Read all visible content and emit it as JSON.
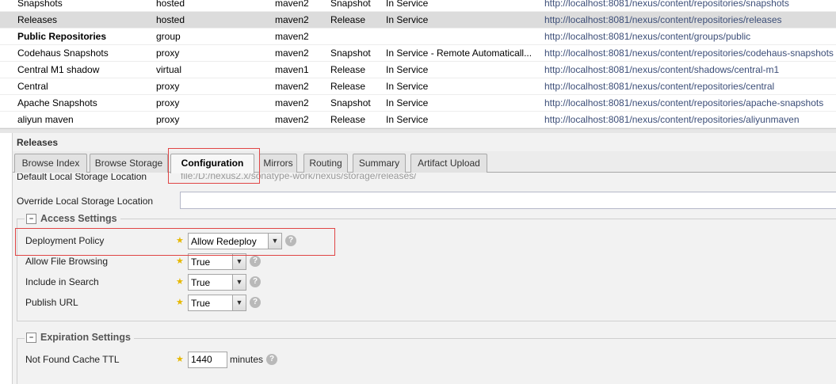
{
  "repositories": [
    {
      "name": "Snapshots",
      "type": "hosted",
      "format": "maven2",
      "policy": "Snapshot",
      "status": "In Service",
      "url": "http://localhost:8081/nexus/content/repositories/snapshots"
    },
    {
      "name": "Releases",
      "type": "hosted",
      "format": "maven2",
      "policy": "Release",
      "status": "In Service",
      "url": "http://localhost:8081/nexus/content/repositories/releases"
    },
    {
      "name": "Public Repositories",
      "type": "group",
      "format": "maven2",
      "policy": "",
      "status": "",
      "url": "http://localhost:8081/nexus/content/groups/public"
    },
    {
      "name": "Codehaus Snapshots",
      "type": "proxy",
      "format": "maven2",
      "policy": "Snapshot",
      "status": "In Service - Remote Automaticall...",
      "url": "http://localhost:8081/nexus/content/repositories/codehaus-snapshots"
    },
    {
      "name": "Central M1 shadow",
      "type": "virtual",
      "format": "maven1",
      "policy": "Release",
      "status": "In Service",
      "url": "http://localhost:8081/nexus/content/shadows/central-m1"
    },
    {
      "name": "Central",
      "type": "proxy",
      "format": "maven2",
      "policy": "Release",
      "status": "In Service",
      "url": "http://localhost:8081/nexus/content/repositories/central"
    },
    {
      "name": "Apache Snapshots",
      "type": "proxy",
      "format": "maven2",
      "policy": "Snapshot",
      "status": "In Service",
      "url": "http://localhost:8081/nexus/content/repositories/apache-snapshots"
    },
    {
      "name": "aliyun maven",
      "type": "proxy",
      "format": "maven2",
      "policy": "Release",
      "status": "In Service",
      "url": "http://localhost:8081/nexus/content/repositories/aliyunmaven"
    }
  ],
  "panel": {
    "title": "Releases",
    "tabs": [
      "Browse Index",
      "Browse Storage",
      "Configuration",
      "Mirrors",
      "Routing",
      "Summary",
      "Artifact Upload"
    ],
    "active_tab": "Configuration"
  },
  "config": {
    "default_storage_label": "Default Local Storage Location",
    "default_storage_value": "file:/D:/nexus2.x/sonatype-work/nexus/storage/releases/",
    "override_storage_label": "Override Local Storage Location",
    "access_settings": {
      "legend": "Access Settings",
      "toggle": "−",
      "deployment_policy_label": "Deployment Policy",
      "deployment_policy_value": "Allow Redeploy",
      "allow_browsing_label": "Allow File Browsing",
      "allow_browsing_value": "True",
      "include_search_label": "Include in Search",
      "include_search_value": "True",
      "publish_url_label": "Publish URL",
      "publish_url_value": "True"
    },
    "expiration_settings": {
      "legend": "Expiration Settings",
      "toggle": "−",
      "not_found_ttl_label": "Not Found Cache TTL",
      "not_found_ttl_value": "1440",
      "not_found_ttl_unit": "minutes"
    }
  },
  "glyphs": {
    "star": "★",
    "help": "?",
    "trigger": "▼"
  },
  "colors": {
    "highlight": "#e04545",
    "url_text": "#3c4e78",
    "selected_row": "#dcdcdc"
  }
}
